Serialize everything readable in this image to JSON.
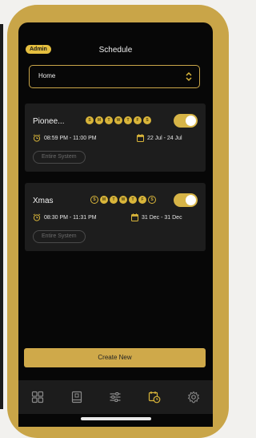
{
  "header": {
    "role_badge": "Admin",
    "title": "Schedule"
  },
  "location_select": {
    "value": "Home"
  },
  "schedules": [
    {
      "name": "Pionee...",
      "days": [
        {
          "letter": "S",
          "active": true
        },
        {
          "letter": "M",
          "active": true
        },
        {
          "letter": "T",
          "active": true
        },
        {
          "letter": "W",
          "active": true
        },
        {
          "letter": "T",
          "active": true
        },
        {
          "letter": "F",
          "active": true
        },
        {
          "letter": "S",
          "active": true
        }
      ],
      "enabled": true,
      "time_range": "08:59 PM  -  11:00 PM",
      "date_range": "22 Jul  -  24 Jul",
      "scope": "Entire System"
    },
    {
      "name": "Xmas",
      "days": [
        {
          "letter": "S",
          "active": false
        },
        {
          "letter": "M",
          "active": true
        },
        {
          "letter": "T",
          "active": true
        },
        {
          "letter": "W",
          "active": true
        },
        {
          "letter": "T",
          "active": true
        },
        {
          "letter": "F",
          "active": true
        },
        {
          "letter": "S",
          "active": false
        }
      ],
      "enabled": true,
      "time_range": "08:30 PM  -  11:31 PM",
      "date_range": "31 Dec  -  31 Dec",
      "scope": "Entire System"
    }
  ],
  "create_button": {
    "label": "Create New"
  },
  "tabbar": {
    "items": [
      {
        "icon": "grid-icon",
        "active": false
      },
      {
        "icon": "book-icon",
        "active": false
      },
      {
        "icon": "sliders-icon",
        "active": false
      },
      {
        "icon": "calendar-clock-icon",
        "active": true
      },
      {
        "icon": "gear-icon",
        "active": false
      }
    ]
  },
  "colors": {
    "accent": "#d9b53a",
    "frame": "#c9a548",
    "background": "#070707",
    "card": "#1d1d1d",
    "tab_inactive": "#8a8a8a"
  }
}
